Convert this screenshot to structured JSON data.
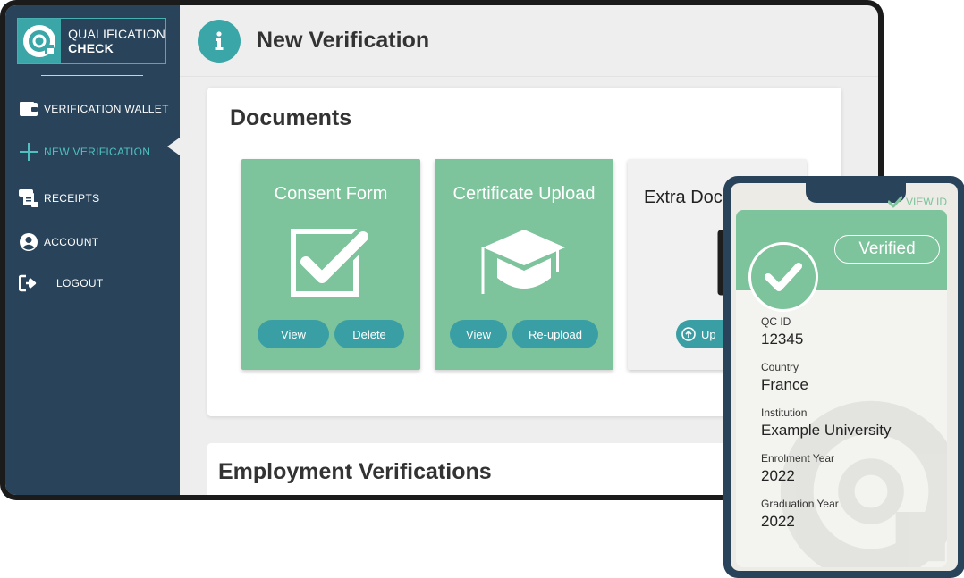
{
  "brand": {
    "name_line1": "QUALIFICATION",
    "name_line2": "CHECK",
    "accent": "#3aa6a7",
    "sidebar_bg": "#28435a",
    "card_green": "#7dc39b"
  },
  "sidebar": {
    "items": [
      {
        "label": "VERIFICATION WALLET",
        "icon": "wallet-icon",
        "active": false
      },
      {
        "label": "NEW VERIFICATION",
        "icon": "plus-icon",
        "active": true
      },
      {
        "label": "RECEIPTS",
        "icon": "receipt-icon",
        "active": false
      },
      {
        "label": "ACCOUNT",
        "icon": "user-circle-icon",
        "active": false
      },
      {
        "label": "LOGOUT",
        "icon": "logout-icon",
        "active": false
      }
    ]
  },
  "header": {
    "title": "New Verification",
    "icon": "info-icon"
  },
  "documents": {
    "title": "Documents",
    "cards": [
      {
        "title": "Consent Form",
        "icon": "checkbox-icon",
        "buttons": [
          "View",
          "Delete"
        ]
      },
      {
        "title": "Certificate Upload",
        "icon": "graduation-cap-icon",
        "buttons": [
          "View",
          "Re-upload"
        ]
      },
      {
        "title": "Extra Doc",
        "icon": "document-icon",
        "buttons": [
          "Up"
        ]
      }
    ]
  },
  "employment": {
    "title": "Employment Verifications"
  },
  "phone": {
    "view_id": "VIEW ID",
    "status": "Verified",
    "fields": [
      {
        "label": "QC ID",
        "value": "12345"
      },
      {
        "label": "Country",
        "value": "France"
      },
      {
        "label": "Institution",
        "value": "Example University"
      },
      {
        "label": "Enrolment Year",
        "value": "2022"
      },
      {
        "label": "Graduation Year",
        "value": "2022"
      }
    ]
  }
}
